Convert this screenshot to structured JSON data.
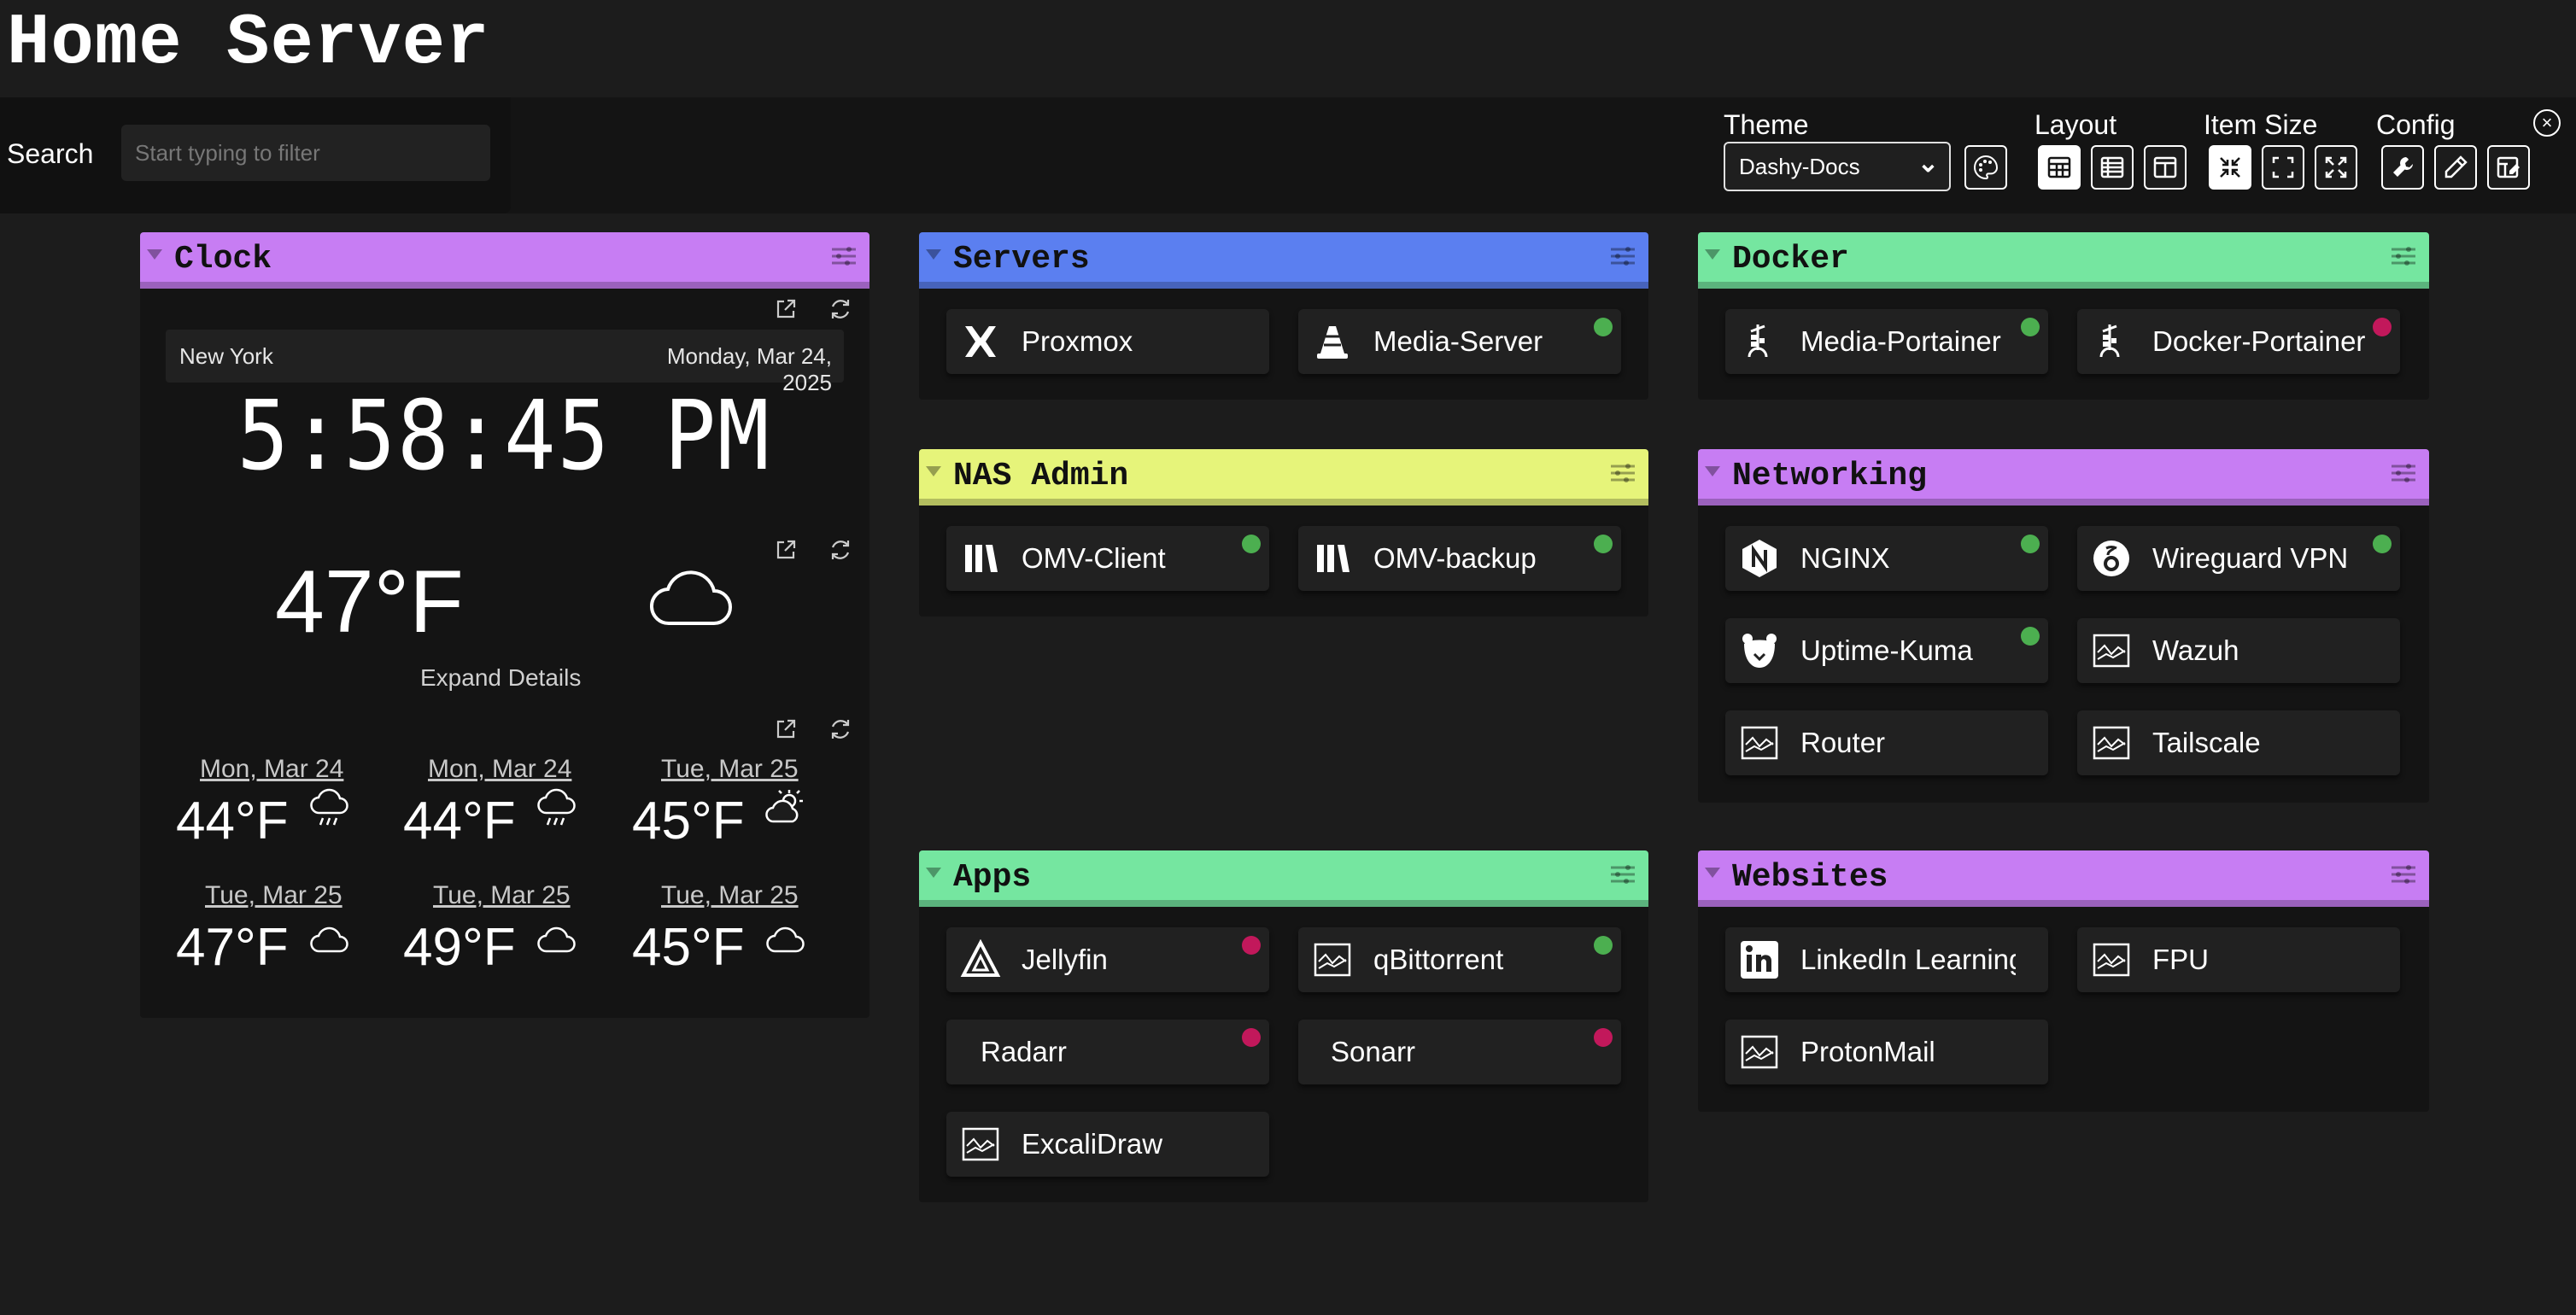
{
  "page": {
    "title": "Home Server"
  },
  "search": {
    "label": "Search",
    "placeholder": "Start typing to filter"
  },
  "options": {
    "theme_label": "Theme",
    "theme_value": "Dashy-Docs",
    "layout_label": "Layout",
    "item_size_label": "Item Size",
    "config_label": "Config"
  },
  "colors": {
    "background": "#1c1c1c",
    "purple": "#c77df3",
    "blue": "#5b7ff0",
    "green": "#75e6a0",
    "yellow": "#e6f47a",
    "status_up": "#4caf50",
    "status_down": "#c2185b"
  },
  "clock": {
    "section_title": "Clock",
    "city": "New York",
    "date": "Monday, Mar 24, 2025",
    "time": "5:58:45 PM"
  },
  "weather": {
    "temp": "47°F",
    "icon": "cloud-icon",
    "expand": "Expand Details"
  },
  "forecast": [
    {
      "day": "Mon, Mar 24",
      "temp": "44°F",
      "icon": "rain-cloud-icon"
    },
    {
      "day": "Mon, Mar 24",
      "temp": "44°F",
      "icon": "rain-cloud-icon"
    },
    {
      "day": "Tue, Mar 25",
      "temp": "45°F",
      "icon": "sun-cloud-icon"
    },
    {
      "day": "Tue, Mar 25",
      "temp": "47°F",
      "icon": "cloud-icon"
    },
    {
      "day": "Tue, Mar 25",
      "temp": "49°F",
      "icon": "cloud-icon"
    },
    {
      "day": "Tue, Mar 25",
      "temp": "45°F",
      "icon": "cloud-icon"
    }
  ],
  "sections": {
    "servers": {
      "title": "Servers",
      "items": [
        {
          "label": "Proxmox",
          "icon": "proxmox-icon",
          "status": ""
        },
        {
          "label": "Media-Server",
          "icon": "vlc-icon",
          "status": "up"
        }
      ]
    },
    "nas_admin": {
      "title": "NAS Admin",
      "items": [
        {
          "label": "OMV-Client",
          "icon": "omv-icon",
          "status": "up"
        },
        {
          "label": "OMV-backup",
          "icon": "omv-icon",
          "status": "up"
        }
      ]
    },
    "apps": {
      "title": "Apps",
      "items": [
        {
          "label": "Jellyfin",
          "icon": "jellyfin-icon",
          "status": "down"
        },
        {
          "label": "qBittorrent",
          "icon": "generic-icon",
          "status": "up"
        },
        {
          "label": "Radarr",
          "icon": "",
          "status": "down"
        },
        {
          "label": "Sonarr",
          "icon": "",
          "status": "down"
        },
        {
          "label": "ExcaliDraw",
          "icon": "generic-icon",
          "status": ""
        }
      ]
    },
    "docker": {
      "title": "Docker",
      "items": [
        {
          "label": "Media-Portainer",
          "icon": "portainer-icon",
          "status": "up"
        },
        {
          "label": "Docker-Portainer",
          "icon": "portainer-icon",
          "status": "down"
        }
      ]
    },
    "networking": {
      "title": "Networking",
      "items": [
        {
          "label": "NGINX",
          "icon": "nginx-icon",
          "status": "up"
        },
        {
          "label": "Wireguard VPN",
          "icon": "wireguard-icon",
          "status": "up"
        },
        {
          "label": "Uptime-Kuma",
          "icon": "uptime-kuma-icon",
          "status": "up"
        },
        {
          "label": "Wazuh",
          "icon": "generic-icon",
          "status": ""
        },
        {
          "label": "Router",
          "icon": "generic-icon",
          "status": ""
        },
        {
          "label": "Tailscale",
          "icon": "generic-icon",
          "status": ""
        }
      ]
    },
    "websites": {
      "title": "Websites",
      "items": [
        {
          "label": "LinkedIn Learning",
          "icon": "linkedin-icon",
          "status": ""
        },
        {
          "label": "FPU",
          "icon": "generic-icon",
          "status": ""
        },
        {
          "label": "ProtonMail",
          "icon": "generic-icon",
          "status": ""
        }
      ]
    }
  }
}
